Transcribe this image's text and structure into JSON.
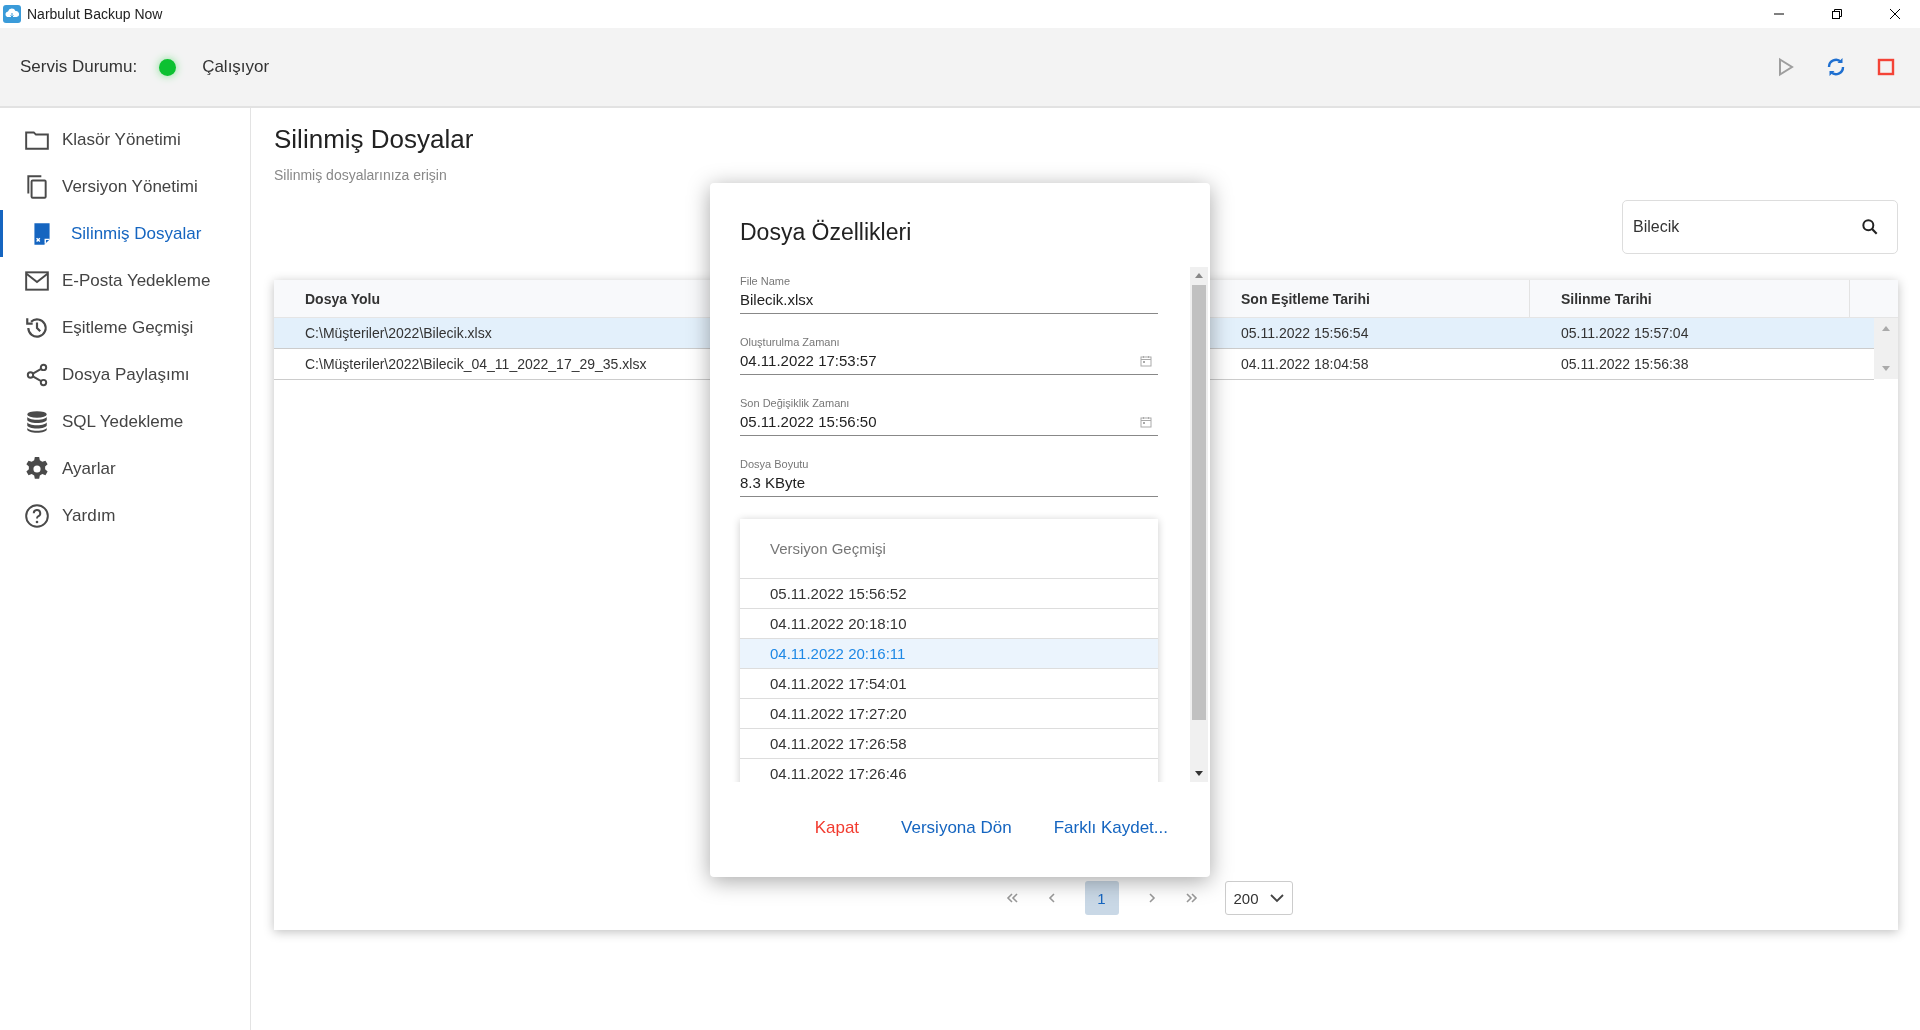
{
  "window": {
    "title": "Narbulut Backup Now"
  },
  "status": {
    "label": "Servis Durumu:",
    "text": "Çalışıyor",
    "on": true
  },
  "toolbar": [
    {
      "disabled": true
    },
    {
      "disabled": false
    },
    {
      "disabled": false
    }
  ],
  "sidebar": {
    "items": [
      {
        "label": "Klasör Yönetimi",
        "selected": false
      },
      {
        "label": "Versiyon Yönetimi",
        "selected": false
      },
      {
        "label": "Silinmiş Dosyalar",
        "selected": true
      },
      {
        "label": "E-Posta Yedekleme",
        "selected": false
      },
      {
        "label": "Eşitleme Geçmişi",
        "selected": false
      },
      {
        "label": "Dosya Paylaşımı",
        "selected": false
      },
      {
        "label": "SQL Yedekleme",
        "selected": false
      },
      {
        "label": "Ayarlar",
        "selected": false
      },
      {
        "label": "Yardım",
        "selected": false
      }
    ]
  },
  "page": {
    "title": "Silinmiş Dosyalar",
    "subtitle": "Silinmiş dosyalarınıza erişin"
  },
  "search": {
    "value": "Bilecik"
  },
  "table": {
    "columns": [
      "Dosya Yolu",
      "Son Eşitleme Tarihi",
      "Silinme Tarihi"
    ],
    "rows": [
      {
        "cells": [
          "C:\\Müşteriler\\2022\\Bilecik.xlsx",
          "05.11.2022 15:56:54",
          "05.11.2022 15:57:04"
        ],
        "selected": true
      },
      {
        "cells": [
          "C:\\Müşteriler\\2022\\Bilecik_04_11_2022_17_29_35.xlsx",
          "04.11.2022 18:04:58",
          "05.11.2022 15:56:38"
        ],
        "selected": false
      }
    ]
  },
  "pagination": {
    "pages": [
      {
        "label": "1",
        "selected": true
      }
    ],
    "page_size": "200"
  },
  "dialog": {
    "title": "Dosya Özellikleri",
    "fields": [
      {
        "label": "File Name",
        "value": "Bilecik.xlsx",
        "kind": "text"
      },
      {
        "label": "Oluşturulma Zamanı",
        "value": "04.11.2022 17:53:57",
        "kind": "datetime"
      },
      {
        "label": "Son Değişiklik Zamanı",
        "value": "05.11.2022 15:56:50",
        "kind": "datetime"
      },
      {
        "label": "Dosya Boyutu",
        "value": "8.3 KByte",
        "kind": "text"
      }
    ],
    "versions": {
      "title": "Versiyon Geçmişi",
      "items": [
        {
          "label": "05.11.2022 15:56:52",
          "selected": false
        },
        {
          "label": "04.11.2022 20:18:10",
          "selected": false
        },
        {
          "label": "04.11.2022 20:16:11",
          "selected": true
        },
        {
          "label": "04.11.2022 17:54:01",
          "selected": false
        },
        {
          "label": "04.11.2022 17:27:20",
          "selected": false
        },
        {
          "label": "04.11.2022 17:26:58",
          "selected": false
        },
        {
          "label": "04.11.2022 17:26:46",
          "selected": false
        }
      ]
    },
    "buttons": [
      {
        "label": "Kapat",
        "kind": "danger"
      },
      {
        "label": "Versiyona Dön",
        "kind": "primary"
      },
      {
        "label": "Farklı Kaydet...",
        "kind": "primary"
      }
    ]
  }
}
